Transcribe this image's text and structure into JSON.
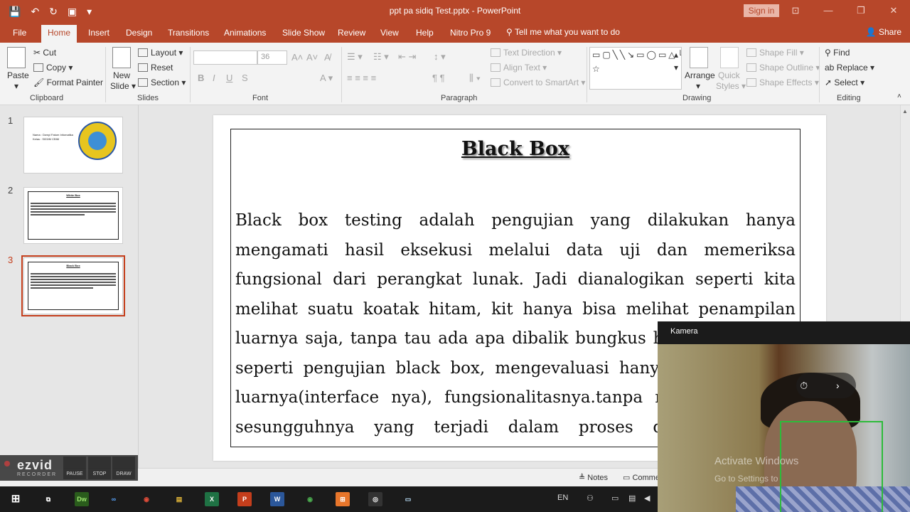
{
  "app": {
    "title": "ppt pa sidiq Test.pptx - PowerPoint",
    "signin": "Sign in"
  },
  "qat": {
    "save": "💾",
    "undo": "↶",
    "redo": "↻",
    "present": "▣",
    "customize": "▾"
  },
  "window": {
    "minimize": "—",
    "restore": "❐",
    "close": "✕",
    "ribbon_display": "⊡"
  },
  "tabs": [
    "File",
    "Home",
    "Insert",
    "Design",
    "Transitions",
    "Animations",
    "Slide Show",
    "Review",
    "View",
    "Help",
    "Nitro Pro 9"
  ],
  "tellme": "Tell me what you want to do",
  "share": "Share",
  "ribbon": {
    "clipboard": {
      "label": "Clipboard",
      "paste": "Paste",
      "cut": "Cut",
      "copy": "Copy",
      "format_painter": "Format Painter"
    },
    "slides": {
      "label": "Slides",
      "new_slide_1": "New",
      "new_slide_2": "Slide ▾",
      "layout": "Layout ▾",
      "reset": "Reset",
      "section": "Section ▾"
    },
    "font": {
      "label": "Font",
      "size": "36",
      "bold": "B",
      "italic": "I",
      "underline": "U",
      "strike": "S",
      "grow": "A˄",
      "shrink": "A˅",
      "clear": "A̸",
      "color": "A ▾"
    },
    "paragraph": {
      "label": "Paragraph",
      "text_direction": "Text Direction ▾",
      "align_text": "Align Text ▾",
      "smartart": "Convert to SmartArt ▾"
    },
    "drawing": {
      "label": "Drawing",
      "arrange": "Arrange",
      "quick_styles_1": "Quick",
      "quick_styles_2": "Styles ▾",
      "shape_fill": "Shape Fill ▾",
      "shape_outline": "Shape Outline ▾",
      "shape_effects": "Shape Effects ▾",
      "shapes_gallery": "▭▢╲╲↘▭◯▭△└┐⇨⇩⌄⇆↰↻⤵{}☆"
    },
    "editing": {
      "label": "Editing",
      "find": "Find",
      "replace": "Replace ▾",
      "select": "Select ▾"
    }
  },
  "thumbnails": [
    {
      "number": "1",
      "line1": "Nama : Dwnyi Fatum Infomatika",
      "line2": "Kelas : SI03/M CBIM"
    },
    {
      "number": "2",
      "title": "White Box"
    },
    {
      "number": "3",
      "title": "Black Box"
    }
  ],
  "slide": {
    "title": "Black Box",
    "body": "Black box testing adalah pengujian yang dilakukan hanya mengamati hasil eksekusi melalui data uji dan memeriksa fungsional dari perangkat lunak. Jadi dianalogikan seperti kita melihat suatu koatak hitam, kit hanya bisa melihat penampilan luarnya saja, tanpa tau ada apa dibalik bungkus hitam nya. Sama seperti pengujian black box, mengevaluasi hanya dari tampilan luarnya(interface nya), fungsionalitasnya.tanpa mengetahui apa sesungguhnya yang terjadi dalam proses detilnya (hanya mengetahui input dan output)."
  },
  "status": {
    "notes": "Notes",
    "comments": "Comme"
  },
  "recorder": {
    "logo": "ezvid",
    "sub": "RECORDER",
    "pause": "PAUSE",
    "stop": "STOP",
    "draw": "DRAW"
  },
  "camera": {
    "title": "Kamera",
    "controls": "⏱ ›",
    "watermark1": "Activate Windows",
    "watermark2": "Go to Settings to"
  },
  "taskbar": {
    "apps": [
      "Dw",
      "∞",
      "◉",
      "▤",
      "X",
      "P",
      "W",
      "◉",
      "⊞",
      "◎",
      "▭"
    ],
    "lang": "EN"
  }
}
